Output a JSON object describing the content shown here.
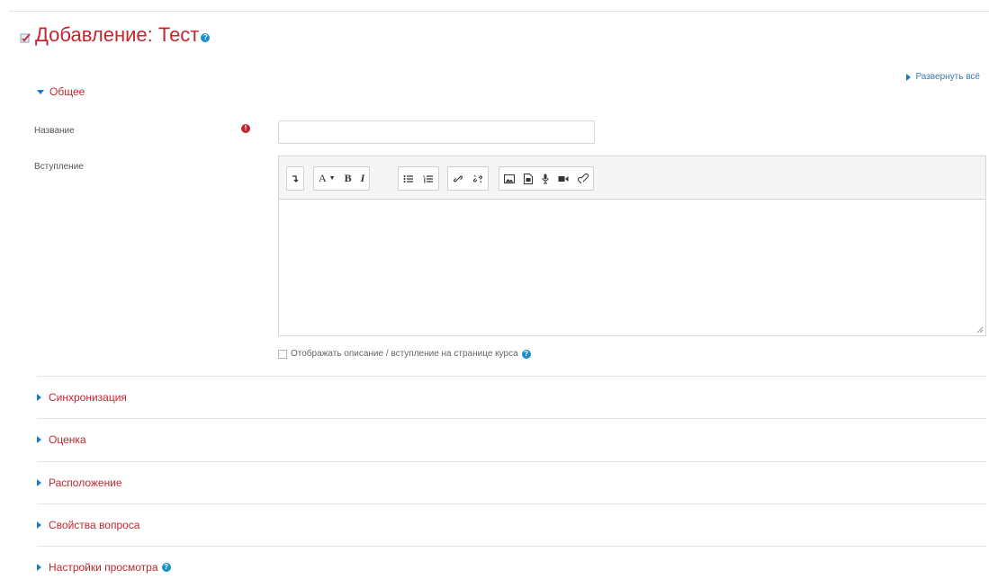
{
  "page": {
    "title": "Добавление: Тест",
    "expand_all": "Развернуть всё"
  },
  "general": {
    "header": "Общее",
    "name_label": "Название",
    "name_value": "",
    "intro_label": "Вступление",
    "show_description_label": "Отображать описание / вступление на странице курса"
  },
  "editor": {
    "toolbar_groups": [
      [
        "collapse-icon"
      ],
      [
        "font-style-icon",
        "bold-icon",
        "italic-icon"
      ],
      [
        "unordered-list-icon",
        "ordered-list-icon"
      ],
      [
        "link-icon",
        "unlink-icon"
      ],
      [
        "image-icon",
        "media-icon",
        "record-audio-icon",
        "record-video-icon",
        "manage-files-icon"
      ]
    ],
    "font_button": "A",
    "bold_button": "B",
    "italic_button": "I"
  },
  "sections": [
    {
      "label": "Синхронизация",
      "help": false
    },
    {
      "label": "Оценка",
      "help": false
    },
    {
      "label": "Расположение",
      "help": false
    },
    {
      "label": "Свойства вопроса",
      "help": false
    },
    {
      "label": "Настройки просмотра",
      "help": true
    }
  ],
  "colors": {
    "accent_red": "#c4262e",
    "link_blue": "#1a7ac1",
    "help_blue": "#1a8fcf"
  }
}
